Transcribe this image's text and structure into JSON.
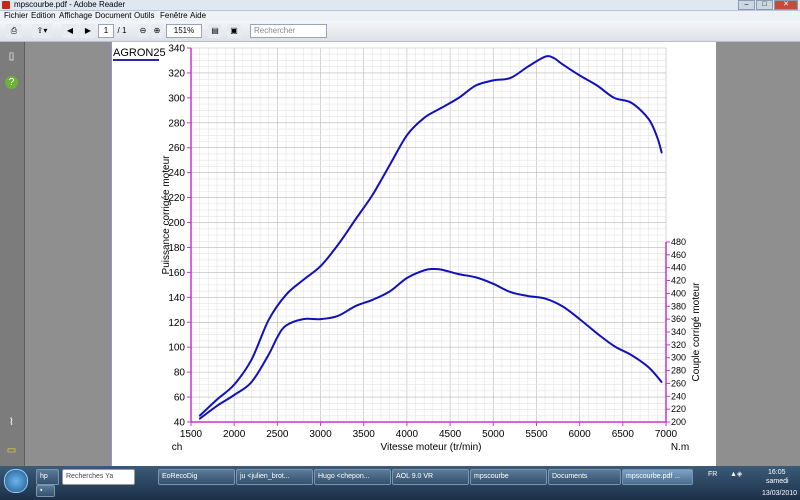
{
  "window": {
    "title": "mpscourbe.pdf - Adobe Reader"
  },
  "menu": [
    "Fichier",
    "Edition",
    "Affichage",
    "Document",
    "Outils",
    "Fenêtre",
    "Aide"
  ],
  "toolbar": {
    "page_current": "1",
    "page_total": "/ 1",
    "zoom": "151%",
    "search_placeholder": "Rechercher"
  },
  "document": {
    "header_label": "AGRON25",
    "accent_color": "#cc33cc",
    "curve_color": "#1111bb"
  },
  "chart_data": {
    "type": "line",
    "xlabel": "Vitesse moteur (tr/min)",
    "ylabel_left": "Puissance corrigée moteur",
    "ylabel_right": "Couple corrigé moteur",
    "unit_left": "ch",
    "unit_right": "N.m",
    "xlim": [
      1500,
      7000
    ],
    "ylim_left": [
      40,
      340
    ],
    "ylim_right": [
      200,
      480
    ],
    "x_ticks": [
      1500,
      2000,
      2500,
      3000,
      3500,
      4000,
      4500,
      5000,
      5500,
      6000,
      6500,
      7000
    ],
    "y_ticks_left": [
      40,
      60,
      80,
      100,
      120,
      140,
      160,
      180,
      200,
      220,
      240,
      260,
      280,
      300,
      320,
      340
    ],
    "y_ticks_right": [
      200,
      220,
      240,
      260,
      280,
      300,
      320,
      340,
      360,
      380,
      400,
      420,
      440,
      460,
      480
    ],
    "grid": true,
    "series": [
      {
        "axis": "left",
        "x": [
          1600,
          1800,
          2000,
          2200,
          2400,
          2600,
          2800,
          3000,
          3200,
          3400,
          3600,
          3800,
          4000,
          4200,
          4400,
          4600,
          4800,
          5000,
          5200,
          5400,
          5600,
          5700,
          5800,
          6000,
          6200,
          6400,
          6600,
          6800,
          6900,
          6950
        ],
        "y": [
          45,
          58,
          70,
          90,
          122,
          142,
          154,
          165,
          182,
          202,
          222,
          246,
          270,
          284,
          292,
          300,
          310,
          314,
          316,
          325,
          333,
          332,
          327,
          318,
          310,
          300,
          296,
          283,
          268,
          256
        ]
      },
      {
        "axis": "right",
        "x": [
          1600,
          1800,
          2000,
          2200,
          2400,
          2500,
          2600,
          2800,
          3000,
          3200,
          3400,
          3600,
          3800,
          4000,
          4200,
          4300,
          4400,
          4600,
          4800,
          5000,
          5200,
          5400,
          5600,
          5800,
          6000,
          6200,
          6400,
          6600,
          6800,
          6950
        ],
        "y": [
          205,
          225,
          242,
          262,
          305,
          332,
          350,
          360,
          360,
          365,
          380,
          390,
          403,
          424,
          436,
          438,
          437,
          430,
          425,
          415,
          402,
          396,
          392,
          380,
          360,
          338,
          318,
          304,
          285,
          262
        ]
      }
    ]
  },
  "taskbar": {
    "search_placeholder": "Recherches Ya",
    "buttons": [
      "EoRecoDig",
      "ju <julien_brot...",
      "Hugo <chepon...",
      "AOL 9.0 VR",
      "mpscourbe",
      "Documents",
      "mpscourbe.pdf ..."
    ],
    "language": "FR",
    "time": "16:05",
    "day": "samedi",
    "date": "13/03/2010"
  }
}
